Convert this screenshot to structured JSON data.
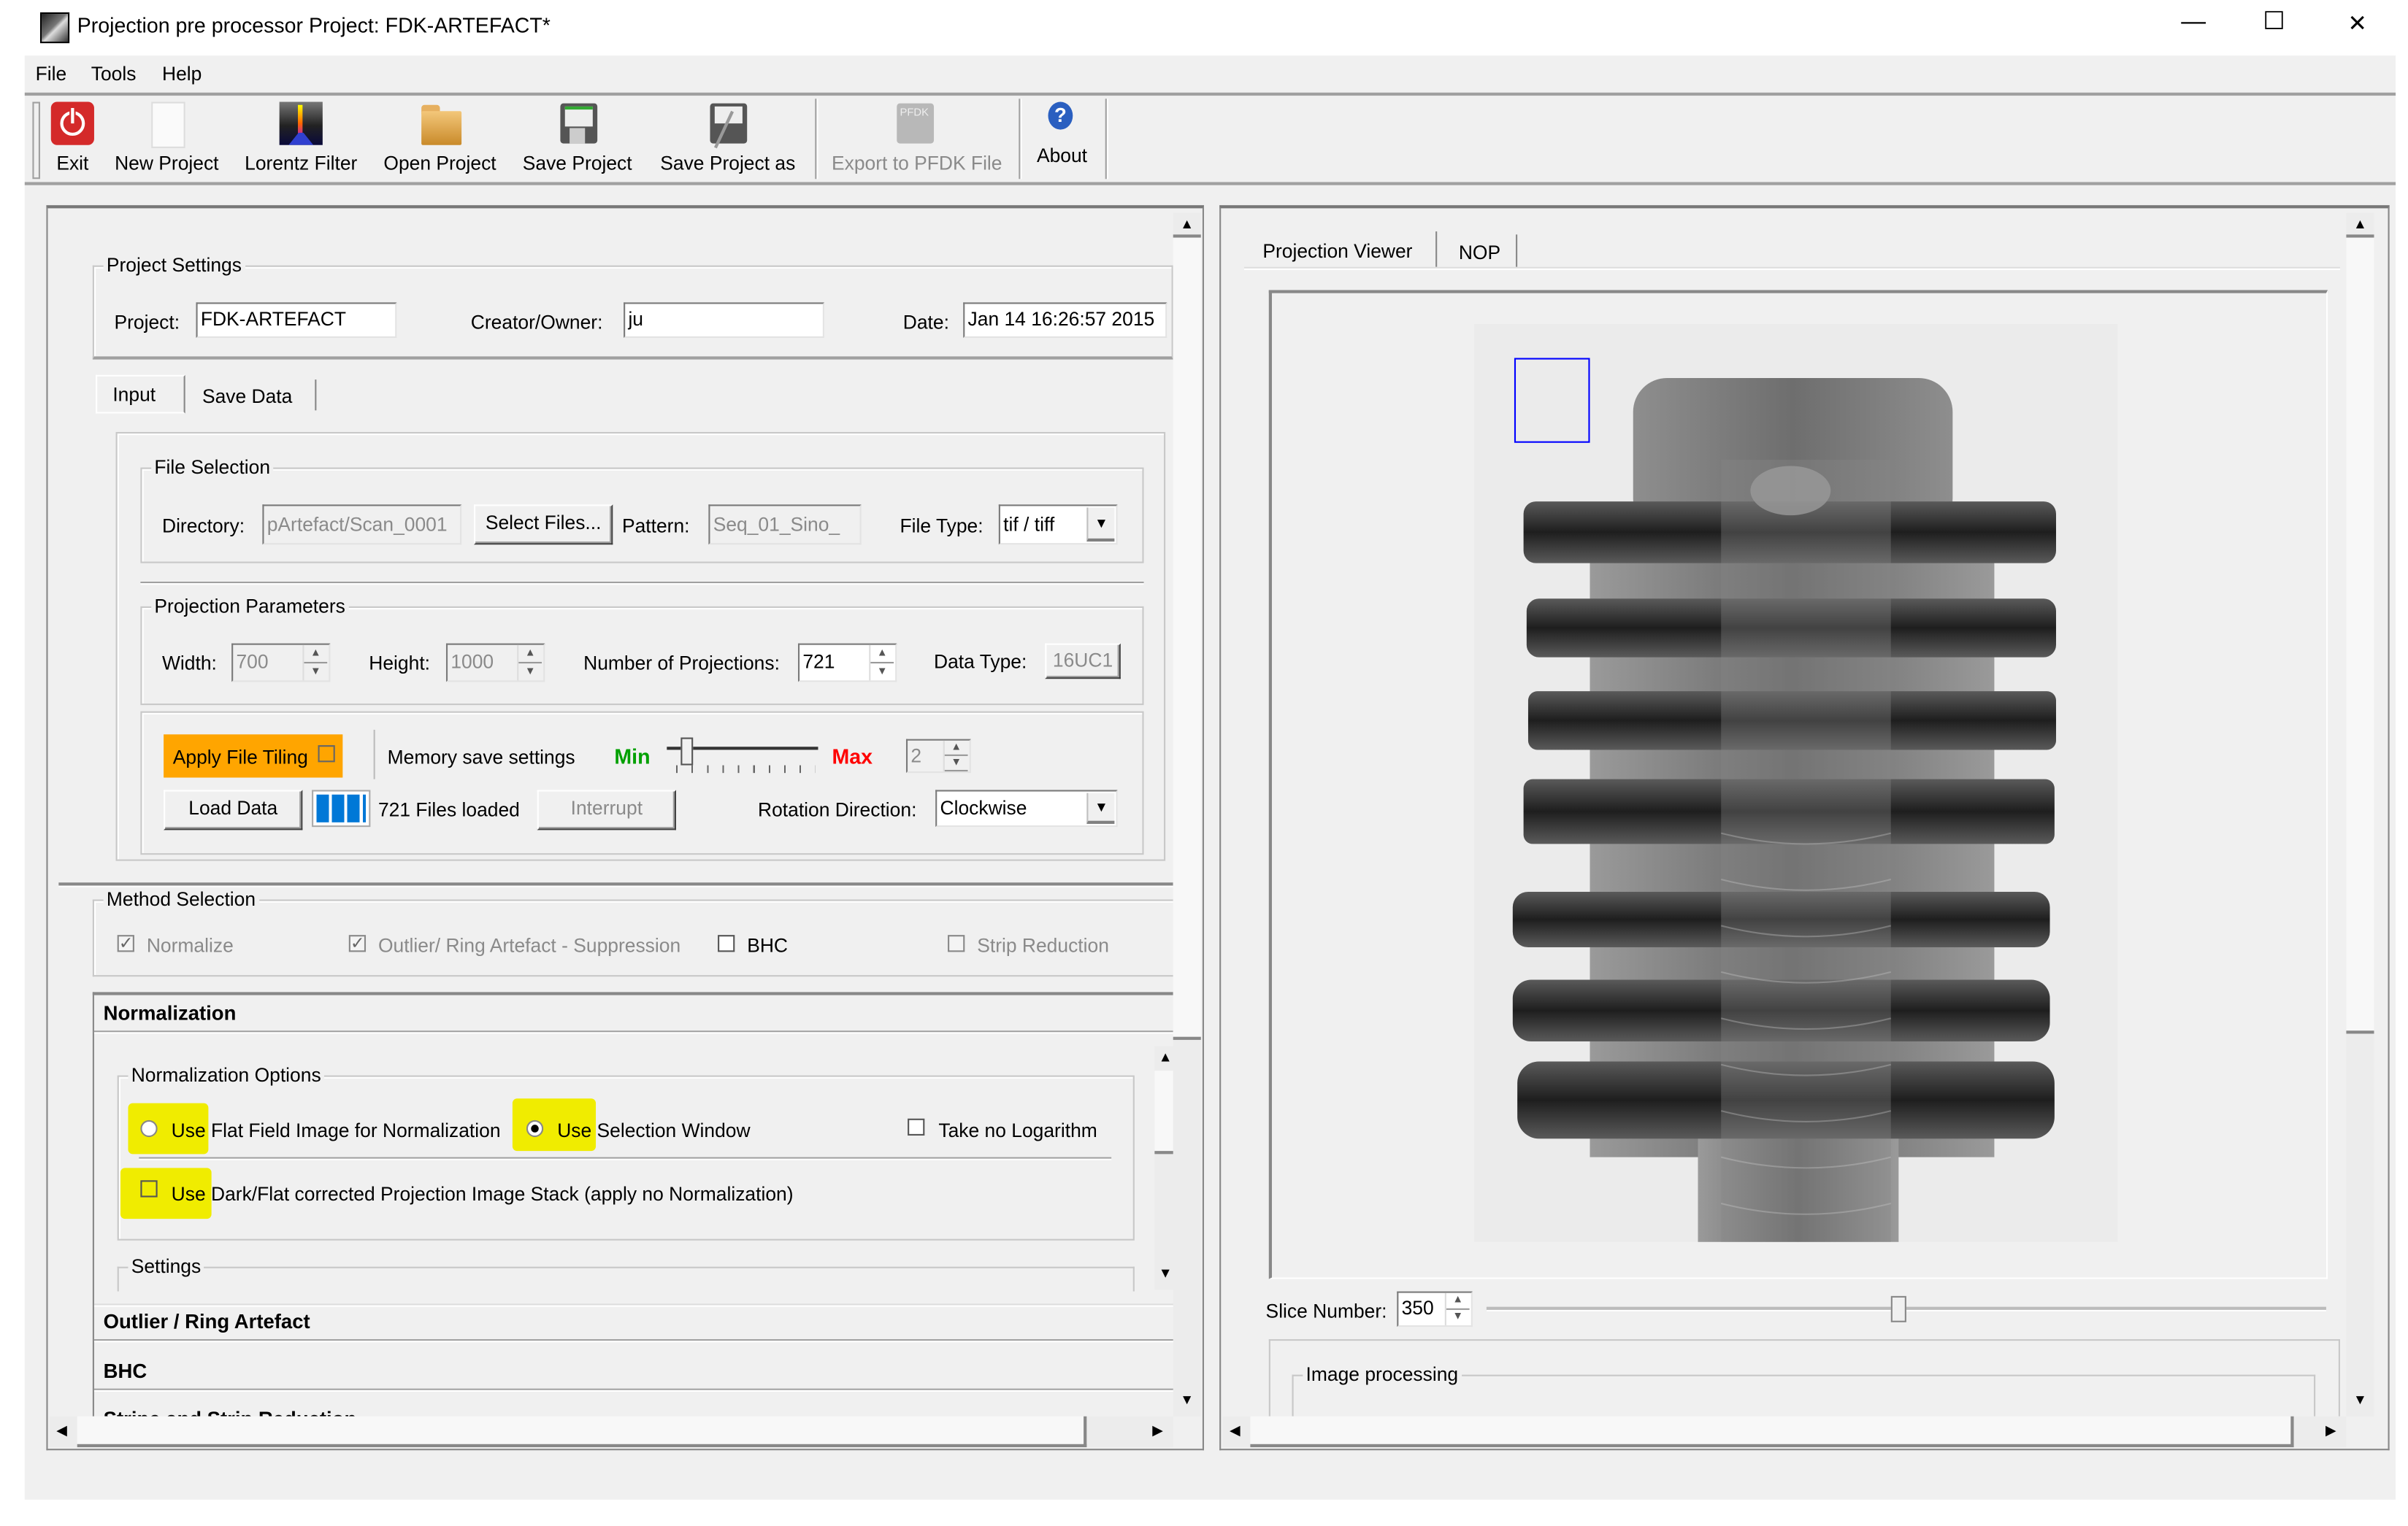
{
  "window": {
    "title": "Projection pre processor Project: FDK-ARTEFACT*",
    "controls": {
      "minimize": "—",
      "maximize": "☐",
      "close": "✕"
    }
  },
  "menu": [
    "File",
    "Tools",
    "Help"
  ],
  "toolbar": [
    {
      "label": "Exit",
      "icon": "power-icon",
      "enabled": true
    },
    {
      "label": "New Project",
      "icon": "new-document-icon",
      "enabled": true
    },
    {
      "label": "Lorentz Filter",
      "icon": "lorentz-filter-icon",
      "enabled": true
    },
    {
      "label": "Open Project",
      "icon": "folder-open-icon",
      "enabled": true
    },
    {
      "label": "Save Project",
      "icon": "floppy-disk-icon",
      "enabled": true
    },
    {
      "label": "Save Project as",
      "icon": "floppy-disk-pen-icon",
      "enabled": true
    },
    {
      "label": "Export to PFDK File",
      "icon": "export-pfdk-icon",
      "enabled": false,
      "icon_text": "PFDK"
    },
    {
      "label": "About",
      "icon": "help-icon",
      "enabled": true,
      "icon_text": "?"
    }
  ],
  "project_settings": {
    "title": "Project Settings",
    "project_label": "Project:",
    "project_value": "FDK-ARTEFACT",
    "creator_label": "Creator/Owner:",
    "creator_value": "ju",
    "date_label": "Date:",
    "date_value": "Jan 14 16:26:57 2015"
  },
  "left_tabs": [
    "Input",
    "Save Data"
  ],
  "file_selection": {
    "title": "File Selection",
    "directory_label": "Directory:",
    "directory_value": "pArtefact/Scan_0001",
    "select_files_button": "Select Files...",
    "pattern_label": "Pattern:",
    "pattern_value": "Seq_01_Sino_",
    "file_type_label": "File Type:",
    "file_type_value": "tif / tiff"
  },
  "projection_parameters": {
    "title": "Projection Parameters",
    "width_label": "Width:",
    "width_value": "700",
    "height_label": "Height:",
    "height_value": "1000",
    "num_projections_label": "Number of Projections:",
    "num_projections_value": "721",
    "data_type_label": "Data Type:",
    "data_type_value": "16UC1"
  },
  "loading": {
    "apply_file_tiling": "Apply File Tiling",
    "apply_file_tiling_checked": false,
    "memory_save_label": "Memory save settings",
    "min_label": "Min",
    "max_label": "Max",
    "memory_slider_fraction": 0.1,
    "memory_value": "2",
    "load_data_button": "Load Data",
    "progress_fraction": 1.0,
    "files_loaded": "721 Files loaded",
    "interrupt_button": "Interrupt",
    "rotation_label": "Rotation Direction:",
    "rotation_value": "Clockwise",
    "colors": {
      "tiling_bg": "#ffa500",
      "min": "#00a000",
      "max": "#ff0000",
      "progress": "#0078d7"
    }
  },
  "method_selection": {
    "title": "Method Selection",
    "items": [
      {
        "label": "Normalize",
        "checked": true,
        "enabled": false
      },
      {
        "label": "Outlier/ Ring Artefact - Suppression",
        "checked": true,
        "enabled": false
      },
      {
        "label": "BHC",
        "checked": false,
        "enabled": true
      },
      {
        "label": "Strip Reduction",
        "checked": false,
        "enabled": false
      }
    ]
  },
  "normalization": {
    "header": "Normalization",
    "options_title": "Normalization Options",
    "use_flat_field": "Use Flat Field Image for Normalization",
    "use_selection_window": "Use Selection Window",
    "take_no_log": "Take no Logarithm",
    "use_dark_flat": "Use Dark/Flat corrected Projection Image Stack (apply no Normalization)",
    "selected": "use_selection_window",
    "settings_title": "Settings",
    "highlight_color": "#f0ec00"
  },
  "sections": [
    "Outlier / Ring Artefact",
    "BHC",
    "Stripe and Strip Reduction"
  ],
  "right_tabs": [
    "Projection Viewer",
    "NOP"
  ],
  "viewer": {
    "slice_label": "Slice Number:",
    "slice_value": "350",
    "slice_fraction": 0.49,
    "selection_color": "#0000ff",
    "image_processing_title": "Image processing"
  }
}
